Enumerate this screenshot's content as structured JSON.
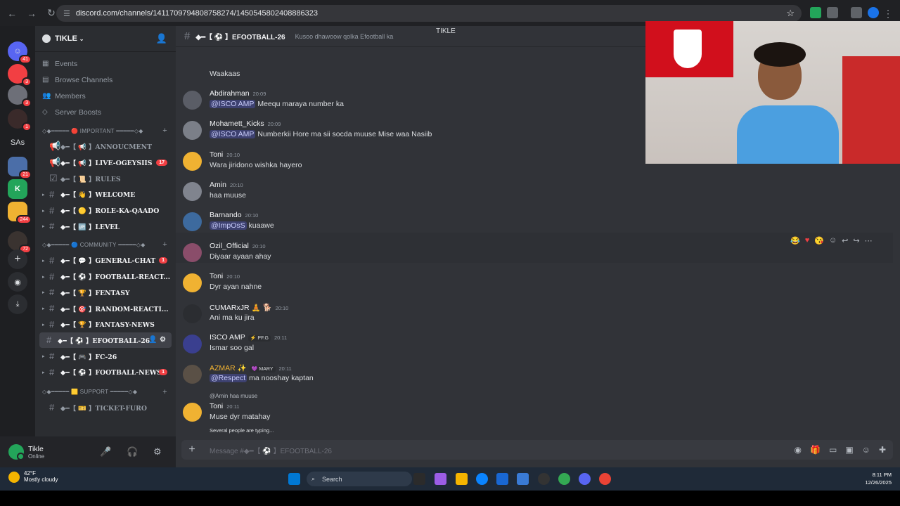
{
  "browser": {
    "url": "discord.com/channels/1411709794808758274/1450545802408886323",
    "back_icon": "arrow-left-icon",
    "forward_icon": "arrow-right-icon",
    "reload_icon": "reload-icon"
  },
  "tab_title": "TIKLE",
  "servers": [
    {
      "label": "",
      "badge": "41"
    },
    {
      "label": "",
      "badge": "3"
    },
    {
      "label": "",
      "badge": "3"
    },
    {
      "label": "",
      "badge": "1"
    },
    {
      "label": "SAs",
      "badge": ""
    },
    {
      "label": "",
      "badge": "21"
    },
    {
      "label": "K",
      "badge": ""
    },
    {
      "label": "",
      "badge": "244"
    },
    {
      "label": "",
      "badge": "72"
    }
  ],
  "guild": {
    "name": "TIKLE"
  },
  "nav": [
    {
      "label": "Events"
    },
    {
      "label": "Browse Channels"
    },
    {
      "label": "Members"
    },
    {
      "label": "Server Boosts"
    }
  ],
  "categories": {
    "important": "◇◆━━━━━ 🔴 IMPORTANT ━━━━━◇◆",
    "community": "◇◆━━━━━ 🔵 COMMUNITY ━━━━━◇◆",
    "support": "◇◆━━━━━ 🟨 SUPPORT ━━━━━◇◆"
  },
  "channels_important": [
    {
      "name": "◆━【 📢 】ANNOUCMENT",
      "badge": ""
    },
    {
      "name": "◆━【 📢 】LIVE-OGEYSIIS",
      "badge": "17"
    },
    {
      "name": "◆━【 📜 】RULES",
      "badge": ""
    },
    {
      "name": "◆━【 👋 】WELCOME",
      "badge": ""
    },
    {
      "name": "◆━【 🟡 】ROLE-KA-QAADO",
      "badge": ""
    },
    {
      "name": "◆━【 🆙 】LEVEL",
      "badge": ""
    }
  ],
  "channels_community": [
    {
      "name": "◆━【 💬 】GENERAL-CHAT",
      "badge": "1"
    },
    {
      "name": "◆━【 ⚽ 】FOOTBALL-REACT...",
      "badge": ""
    },
    {
      "name": "◆━【 🏆 】FENTASY",
      "badge": ""
    },
    {
      "name": "◆━【 🎯 】RANDOM-REACTI...",
      "badge": ""
    },
    {
      "name": "◆━【 🏆 】FANTASY-NEWS",
      "badge": ""
    },
    {
      "name": "◆━【 ⚽ 】EFOOTBALL-26",
      "badge": ""
    },
    {
      "name": "◆━【 🎮 】FC-26",
      "badge": ""
    },
    {
      "name": "◆━【 ⚽ 】FOOTBALL-NEWS",
      "badge": "1"
    }
  ],
  "channels_support": [
    {
      "name": "◆━【 🎫 】TICKET-FURO",
      "badge": ""
    }
  ],
  "header": {
    "title": "◆━【 ⚽ 】EFOOTBALL-26",
    "topic": "Kusoo dhawoow qolka Efootball ka"
  },
  "messages": [
    {
      "author": "",
      "time": "",
      "text": "Waakaas"
    },
    {
      "author": "Abdirahman",
      "time": "20:09",
      "mention": "@ISCO AMP",
      "text": "Meequ maraya number ka"
    },
    {
      "author": "Mohamett_Kicks",
      "time": "20:09",
      "mention": "@ISCO AMP",
      "text": "Numberkii Hore ma sii socda muuse Mise waa Nasiib"
    },
    {
      "author": "Toni",
      "time": "20:10",
      "text": "Wara jiridono wishka hayero"
    },
    {
      "author": "Amin",
      "time": "20:10",
      "text": "haa muuse"
    },
    {
      "author": "Barnando",
      "time": "20:10",
      "mention": "@ImpOsS",
      "text": "kuaawe"
    },
    {
      "author": "Ozil_Official",
      "time": "20:10",
      "text": "Diyaar ayaan ahay"
    },
    {
      "author": "Toni",
      "time": "20:10",
      "text": "Dyr ayan nahne"
    },
    {
      "author": "CUMARxJR 🧘 🐕",
      "time": "20:10",
      "text": "Ani ma ku jira"
    },
    {
      "author": "ISCO AMP",
      "tag": "⚡ PF.G",
      "time": "20:11",
      "text": "Ismar soo gal"
    },
    {
      "author": "AZMAR ✨",
      "tag": "💜 MARY",
      "time": "20:11",
      "mention": "@Respect",
      "text": "ma nooshay kaptan"
    },
    {
      "author": "Toni",
      "time": "20:11",
      "reply": "@Amin haa muuse",
      "text": "Muse dyr matahay"
    }
  ],
  "typing": "Several people are typing...",
  "input_placeholder": "Message #◆━【 ⚽ 】EFOOTBALL-26",
  "user": {
    "name": "Tikle",
    "status": "Online"
  },
  "taskbar": {
    "temp": "42°F",
    "weather": "Mostly cloudy",
    "search": "Search",
    "time": "8:11 PM",
    "date": "12/26/2025",
    "weather_badge": "1"
  },
  "colors": {
    "accent": "#5865f2",
    "sidebar": "#2b2d31",
    "chat": "#313338",
    "mention_red": "#f23f43",
    "name_orange": "#f0b232"
  }
}
